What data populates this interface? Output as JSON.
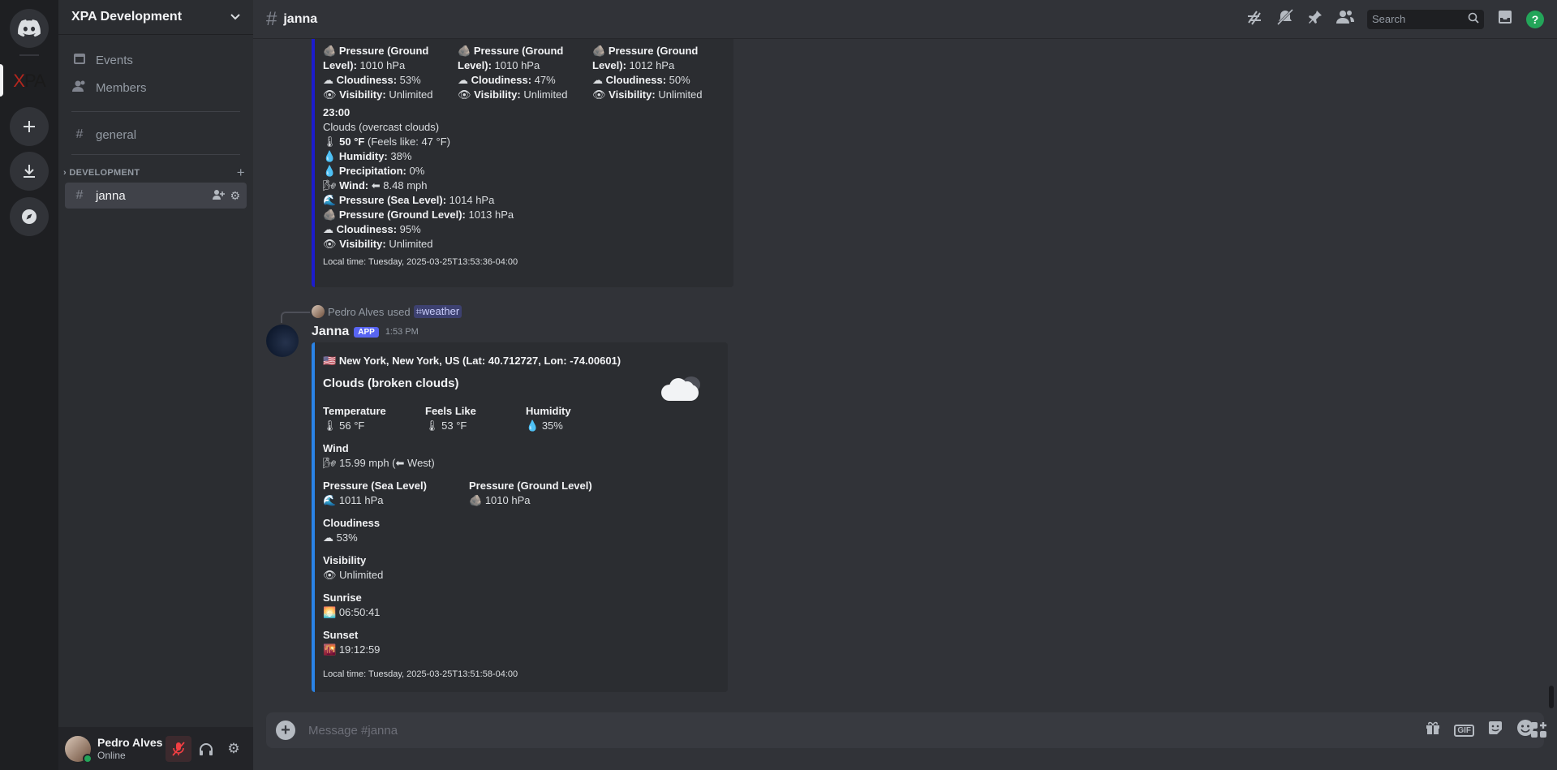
{
  "server": {
    "name": "XPA Development",
    "logo_x": "X",
    "logo_rest": "PA"
  },
  "sidebar": {
    "events": "Events",
    "members": "Members",
    "general": "general",
    "category": "DEVELOPMENT",
    "active_channel": "janna"
  },
  "user": {
    "name": "Pedro Alves",
    "status": "Online"
  },
  "header": {
    "channel": "janna",
    "search_placeholder": "Search"
  },
  "embed1": {
    "col1": {
      "p1": "Pressure (Ground",
      "p2": "Level):",
      "pv": "1010 hPa",
      "cl": "Cloudiness:",
      "clv": "53%",
      "vis": "Visibility:",
      "visv": "Unlimited"
    },
    "col2": {
      "p1": "Pressure (Ground",
      "p2": "Level):",
      "pv": "1010 hPa",
      "cl": "Cloudiness:",
      "clv": "47%",
      "vis": "Visibility:",
      "visv": "Unlimited"
    },
    "col3": {
      "p1": "Pressure (Ground",
      "p2": "Level):",
      "pv": "1012 hPa",
      "cl": "Cloudiness:",
      "clv": "50%",
      "vis": "Visibility:",
      "visv": "Unlimited"
    },
    "hour": "23:00",
    "condition": "Clouds (overcast clouds)",
    "temp": "50 °F",
    "feels": "(Feels like: 47 °F)",
    "humidity_label": "Humidity:",
    "humidity": "38%",
    "precip_label": "Precipitation:",
    "precip": "0%",
    "wind_label": "Wind:",
    "wind": "8.48 mph",
    "sea_label": "Pressure (Sea Level):",
    "sea": "1014 hPa",
    "ground_label": "Pressure (Ground Level):",
    "ground": "1013 hPa",
    "cloud_label": "Cloudiness:",
    "cloud": "95%",
    "vis_label": "Visibility:",
    "vis": "Unlimited",
    "local_time": "Local time: Tuesday, 2025-03-25T13:53:36-04:00"
  },
  "reply": {
    "user": "Pedro Alves",
    "used": "used",
    "command": "weather"
  },
  "message": {
    "author": "Janna",
    "tag": "APP",
    "time": "1:53 PM"
  },
  "embed2": {
    "location": "New York, New York, US (Lat: 40.712727, Lon: -74.00601)",
    "condition": "Clouds (broken clouds)",
    "temp_label": "Temperature",
    "temp": "56 °F",
    "feels_label": "Feels Like",
    "feels": "53 °F",
    "humidity_label": "Humidity",
    "humidity": "35%",
    "wind_label": "Wind",
    "wind_speed": "15.99 mph (",
    "wind_dir": "West)",
    "sea_label": "Pressure (Sea Level)",
    "sea": "1011 hPa",
    "ground_label": "Pressure (Ground Level)",
    "ground": "1010 hPa",
    "cloud_label": "Cloudiness",
    "cloud": "53%",
    "vis_label": "Visibility",
    "vis": "Unlimited",
    "sunrise_label": "Sunrise",
    "sunrise": "06:50:41",
    "sunset_label": "Sunset",
    "sunset": "19:12:59",
    "local_time": "Local time: Tuesday, 2025-03-25T13:51:58-04:00"
  },
  "composer": {
    "placeholder": "Message #janna"
  },
  "icons": {
    "thermometer": "🌡",
    "drop": "💧",
    "wind": "🌬",
    "arrow": "⬅",
    "wave": "🌊",
    "rock": "🪨",
    "cloud": "☁",
    "eye": "👁",
    "flag": "🇺🇸",
    "sunrise": "🌅",
    "sunset": "🌇"
  }
}
